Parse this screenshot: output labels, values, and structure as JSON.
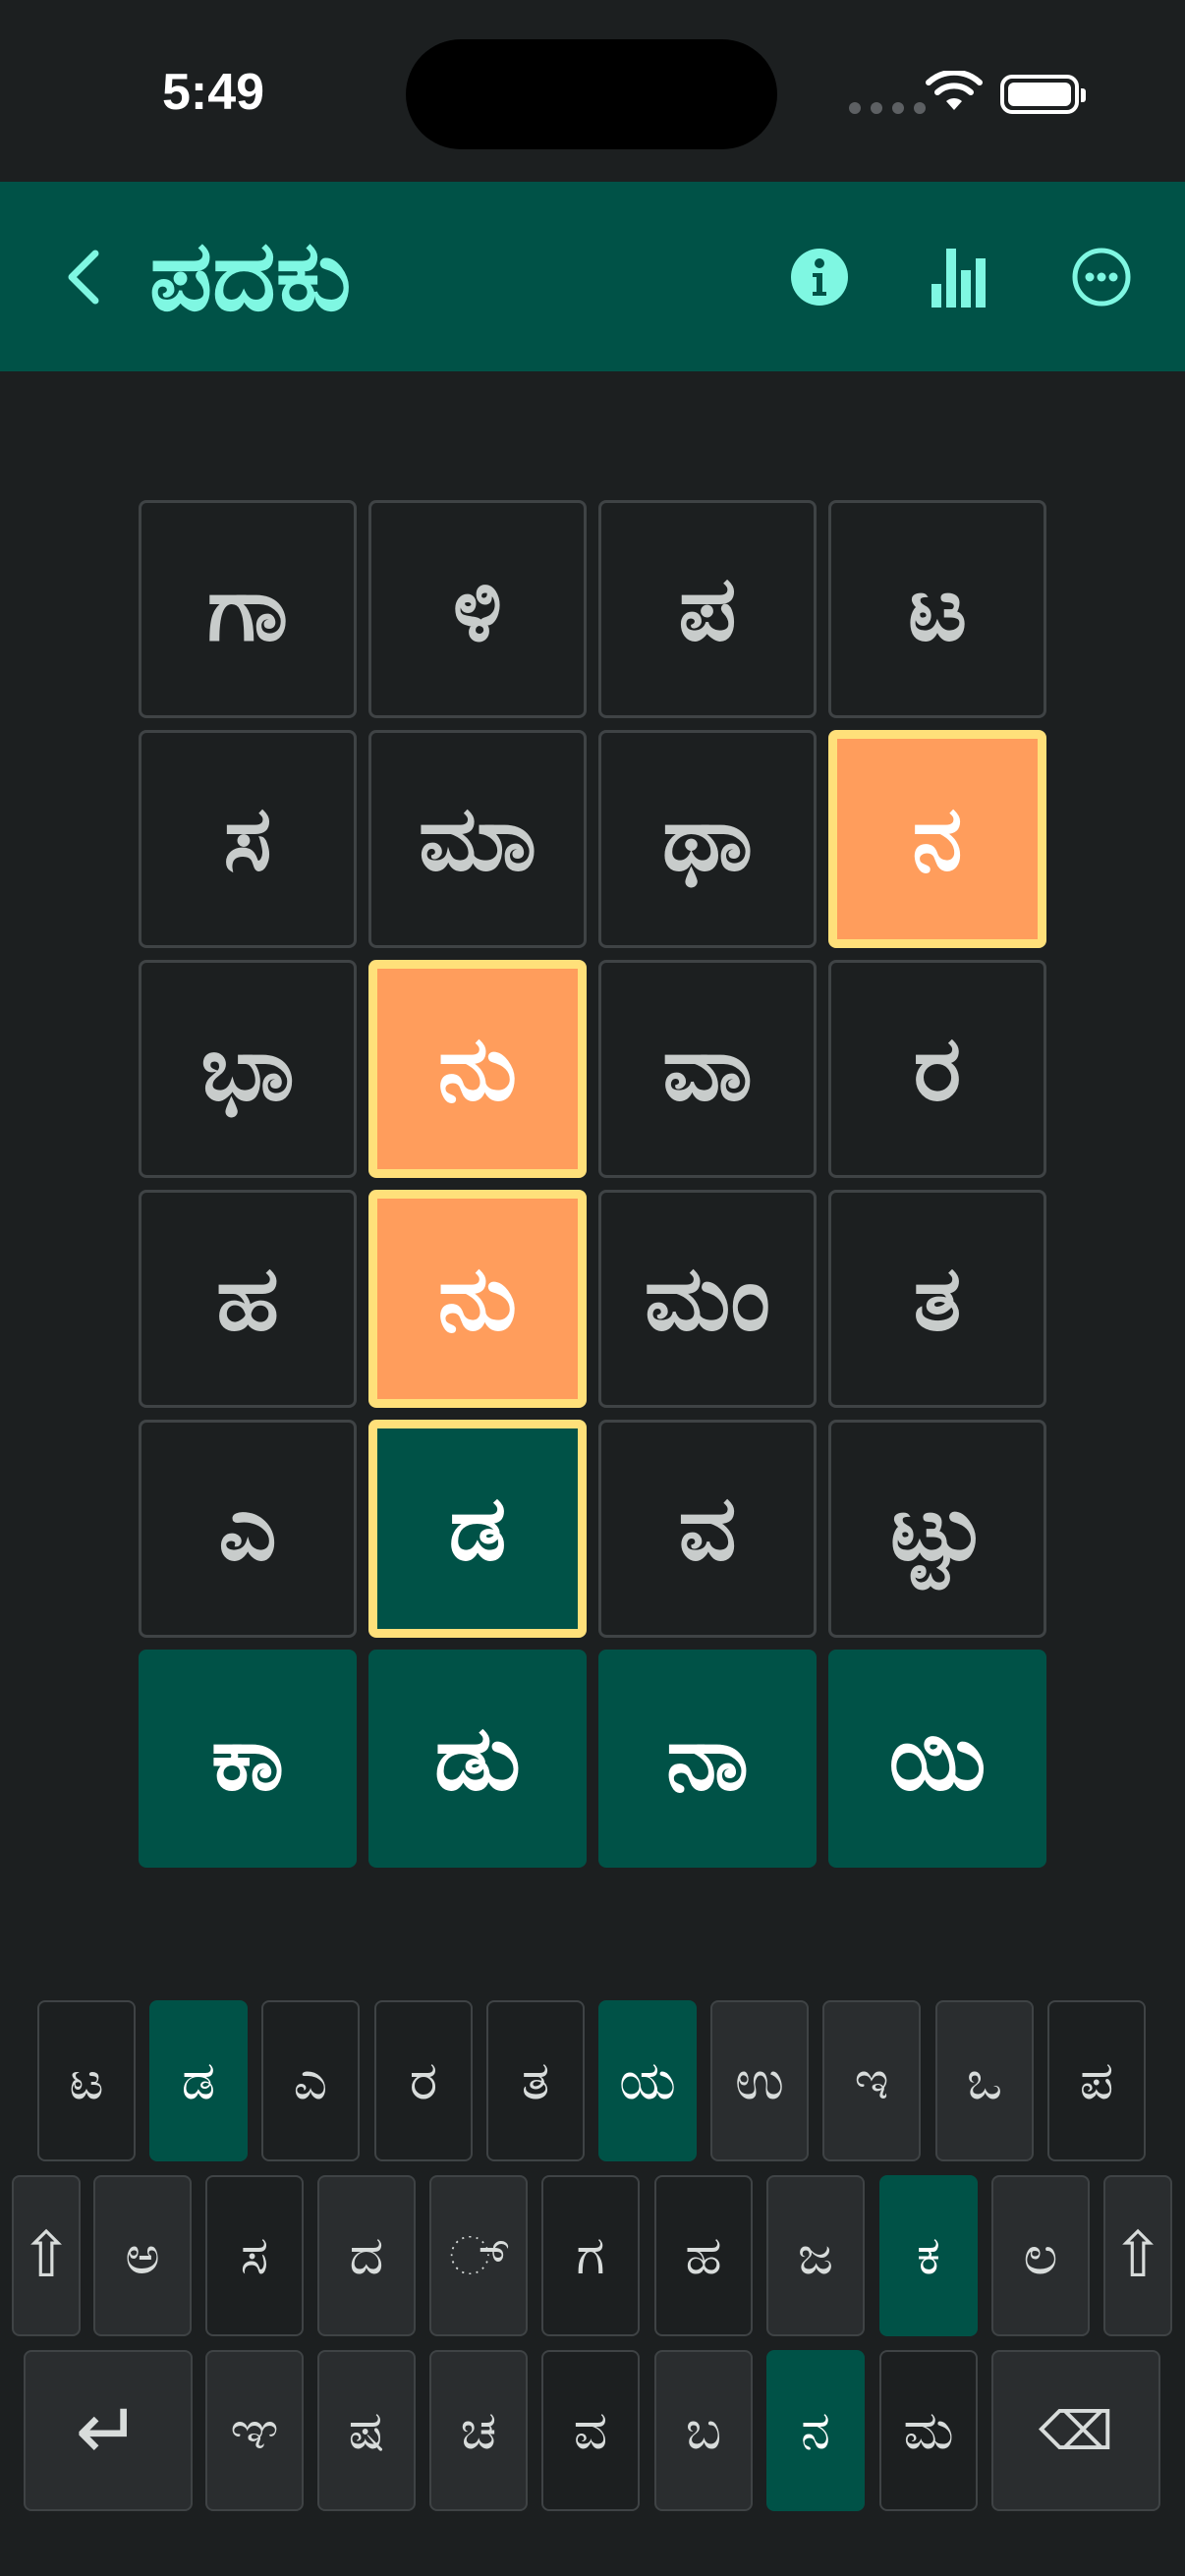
{
  "status": {
    "time": "5:49"
  },
  "header": {
    "title": "ಪದಕು",
    "icons": [
      "chevron-left-icon",
      "info-icon",
      "stats-icon",
      "more-icon"
    ],
    "accent_color": "#7ff7e2",
    "background": "#005247"
  },
  "board": {
    "rows": [
      [
        {
          "letter": "ಗಾ",
          "state": "empty"
        },
        {
          "letter": "ಳಿ",
          "state": "empty"
        },
        {
          "letter": "ಪ",
          "state": "empty"
        },
        {
          "letter": "ಟ",
          "state": "empty"
        }
      ],
      [
        {
          "letter": "ಸ",
          "state": "empty"
        },
        {
          "letter": "ಮಾ",
          "state": "empty"
        },
        {
          "letter": "ಥಾ",
          "state": "empty"
        },
        {
          "letter": "ನ",
          "state": "present"
        }
      ],
      [
        {
          "letter": "ಭಾ",
          "state": "empty"
        },
        {
          "letter": "ನು",
          "state": "present"
        },
        {
          "letter": "ವಾ",
          "state": "empty"
        },
        {
          "letter": "ರ",
          "state": "empty"
        }
      ],
      [
        {
          "letter": "ಹ",
          "state": "empty"
        },
        {
          "letter": "ನು",
          "state": "present"
        },
        {
          "letter": "ಮಂ",
          "state": "empty"
        },
        {
          "letter": "ತ",
          "state": "empty"
        }
      ],
      [
        {
          "letter": "ಎ",
          "state": "empty"
        },
        {
          "letter": "ಡ",
          "state": "correct-sel"
        },
        {
          "letter": "ವ",
          "state": "empty"
        },
        {
          "letter": "ಟ್ಟು",
          "state": "empty"
        }
      ],
      [
        {
          "letter": "ಕಾ",
          "state": "correct"
        },
        {
          "letter": "ಡು",
          "state": "correct"
        },
        {
          "letter": "ನಾ",
          "state": "correct"
        },
        {
          "letter": "ಯಿ",
          "state": "correct"
        }
      ]
    ],
    "colors": {
      "present": "#ff9d5c",
      "selected_border": "#ffe07a",
      "correct": "#005247"
    }
  },
  "keyboard": {
    "rows": [
      [
        {
          "label": "ಟ",
          "state": "default"
        },
        {
          "label": "ಡ",
          "state": "correct"
        },
        {
          "label": "ಎ",
          "state": "default"
        },
        {
          "label": "ರ",
          "state": "default"
        },
        {
          "label": "ತ",
          "state": "default"
        },
        {
          "label": "ಯ",
          "state": "correct"
        },
        {
          "label": "ಉ",
          "state": "wide"
        },
        {
          "label": "ಇ",
          "state": "wide"
        },
        {
          "label": "ಒ",
          "state": "wide"
        },
        {
          "label": "ಪ",
          "state": "default"
        }
      ],
      [
        {
          "label": "⇧",
          "state": "wide"
        },
        {
          "label": "ಅ",
          "state": "wide"
        },
        {
          "label": "ಸ",
          "state": "default"
        },
        {
          "label": "ದ",
          "state": "wide"
        },
        {
          "label": "◌್",
          "state": "wide"
        },
        {
          "label": "ಗ",
          "state": "default"
        },
        {
          "label": "ಹ",
          "state": "default"
        },
        {
          "label": "ಜ",
          "state": "wide"
        },
        {
          "label": "ಕ",
          "state": "correct"
        },
        {
          "label": "ಲ",
          "state": "wide"
        },
        {
          "label": "⇧",
          "state": "wide"
        }
      ],
      [
        {
          "label": "↵",
          "state": "wide"
        },
        {
          "label": "ಞ",
          "state": "wide"
        },
        {
          "label": "ಷ",
          "state": "wide"
        },
        {
          "label": "ಚ",
          "state": "wide"
        },
        {
          "label": "ವ",
          "state": "default"
        },
        {
          "label": "ಬ",
          "state": "wide"
        },
        {
          "label": "ನ",
          "state": "correct"
        },
        {
          "label": "ಮ",
          "state": "default"
        },
        {
          "label": "⌫",
          "state": "wide"
        }
      ]
    ]
  }
}
